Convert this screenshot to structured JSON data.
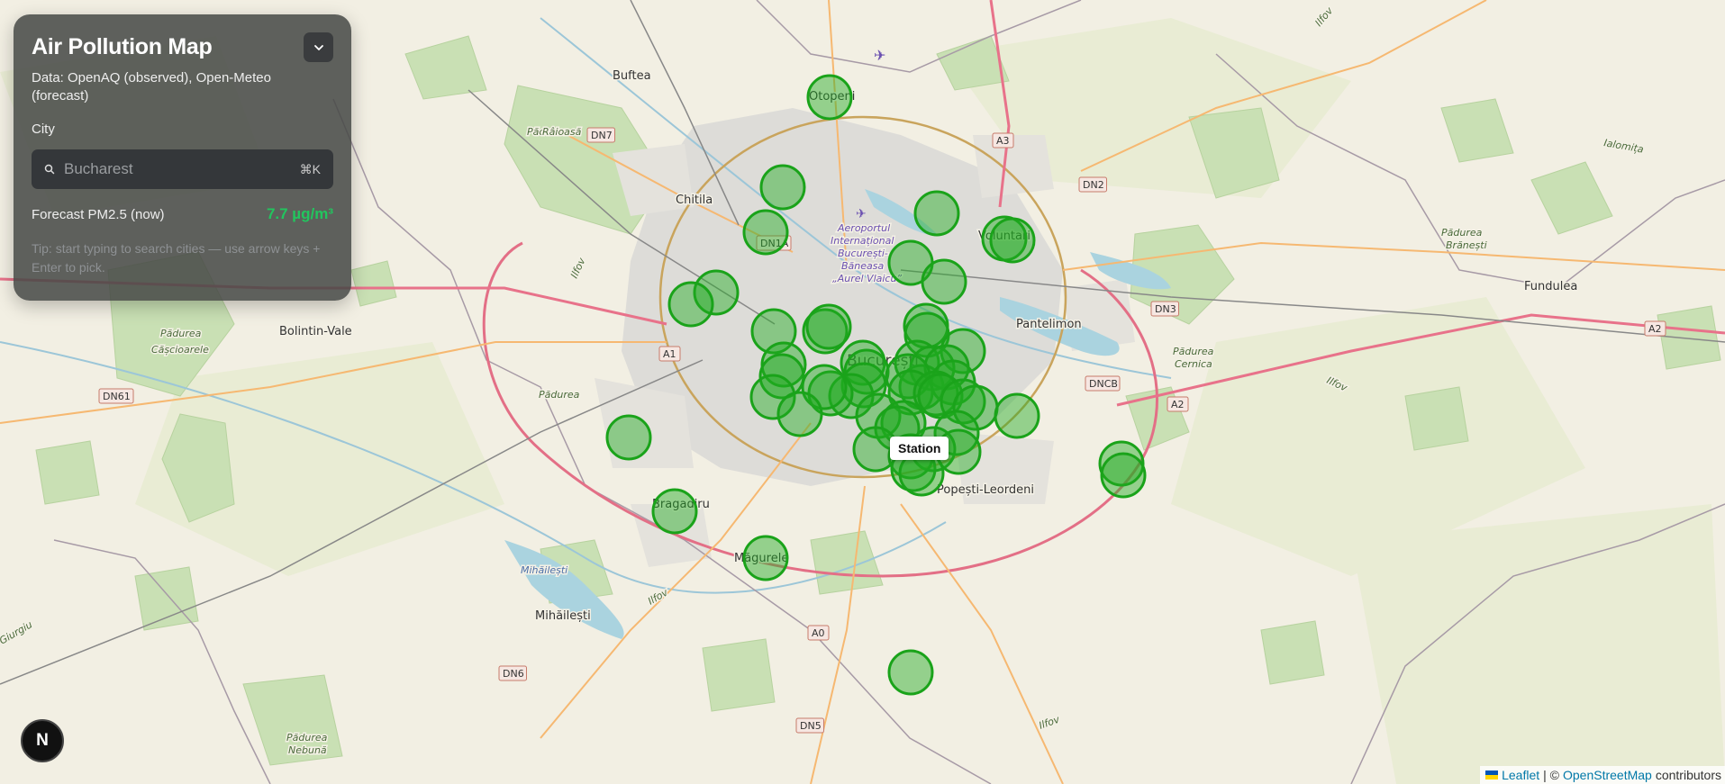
{
  "panel": {
    "title": "Air Pollution Map",
    "subtitle": "Data: OpenAQ (observed), Open-Meteo (forecast)",
    "city_label": "City",
    "search_placeholder": "Bucharest",
    "search_shortcut": "⌘K",
    "forecast_label": "Forecast PM2.5 (now)",
    "forecast_value": "7.7 µg/m³",
    "tip": "Tip: start typing to search cities — use arrow keys + Enter to pick.",
    "collapse_icon": "chevron-down-icon",
    "search_icon": "search-icon"
  },
  "tooltip": {
    "label": "Station"
  },
  "logo": {
    "letter": "N"
  },
  "attribution": {
    "leaflet": "Leaflet",
    "separator": "| ©",
    "osm": "OpenStreetMap",
    "suffix": "contributors"
  },
  "map": {
    "places": [
      {
        "id": "buftea",
        "name": "Buftea"
      },
      {
        "id": "otopeni",
        "name": "Otopeni"
      },
      {
        "id": "chitila",
        "name": "Chitila"
      },
      {
        "id": "voluntari",
        "name": "Voluntari"
      },
      {
        "id": "pantelimon",
        "name": "Pantelimon"
      },
      {
        "id": "fundulea",
        "name": "Fundulea"
      },
      {
        "id": "bolintin",
        "name": "Bolintin-Vale"
      },
      {
        "id": "bucuresti",
        "name": "București"
      },
      {
        "id": "bragadiru",
        "name": "Bragadiru"
      },
      {
        "id": "magurele",
        "name": "Măgurele"
      },
      {
        "id": "popesti",
        "name": "Popești-Leordeni"
      },
      {
        "id": "mihailesti",
        "name": "Mihăilești"
      },
      {
        "id": "ialomita",
        "name": "Ialomița"
      },
      {
        "id": "ilfov1",
        "name": "Ilfov"
      },
      {
        "id": "ilfov2",
        "name": "Ilfov"
      },
      {
        "id": "ilfov3",
        "name": "Ilfov"
      },
      {
        "id": "ilfov4",
        "name": "Ilfov"
      },
      {
        "id": "ilfov5",
        "name": "Ilfov"
      },
      {
        "id": "giurgiu",
        "name": "Giurgiu"
      }
    ],
    "nature": [
      {
        "id": "raioasa",
        "lines": [
          "Pădurea",
          "Râioasă"
        ]
      },
      {
        "id": "brianesti",
        "lines": [
          "Pădurea",
          "Brănești"
        ]
      },
      {
        "id": "cernica",
        "lines": [
          "Pădurea",
          "Cernica"
        ]
      },
      {
        "id": "cascioarele",
        "lines": [
          "Pădurea",
          "Cășcioarele"
        ]
      },
      {
        "id": "nebuna",
        "lines": [
          "Pădurea",
          "Nebună"
        ]
      },
      {
        "id": "lake-mihailesti",
        "lines": [
          "Mihăilești"
        ]
      }
    ],
    "airport": [
      "Aeroportul",
      "Internațional",
      "București-",
      "Băneasa",
      "„Aurel Vlaicu”"
    ],
    "roads": [
      "DN7",
      "A3",
      "DN2",
      "DN1A",
      "DN3",
      "A1",
      "DNCB",
      "A2",
      "A2",
      "DN61",
      "A0",
      "DN6",
      "DN5"
    ]
  }
}
